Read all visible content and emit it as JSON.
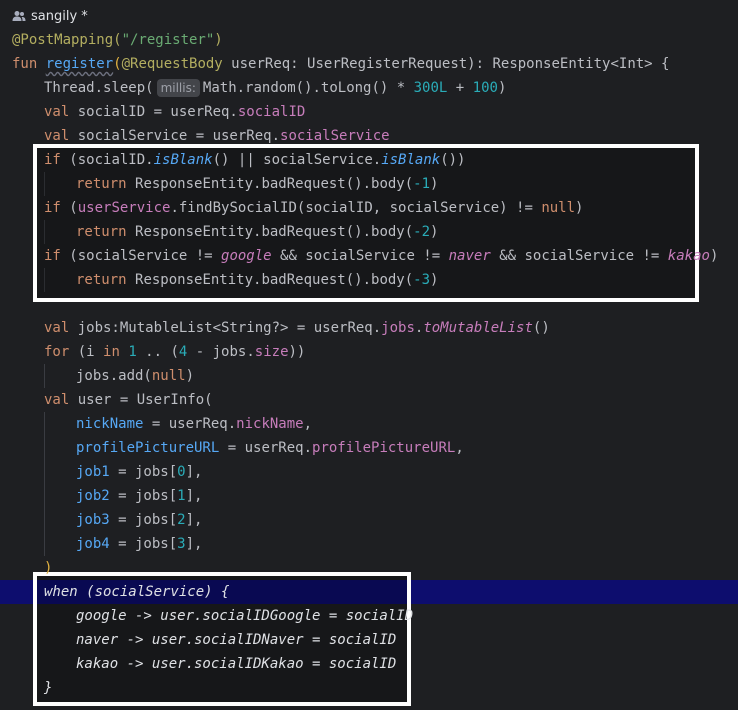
{
  "author": {
    "name": "sangily *",
    "icon": "people-icon"
  },
  "colors": {
    "background": "#1e1f22",
    "keyword": "#cf8e6d",
    "annotation": "#b3ae60",
    "string": "#6aab73",
    "number": "#2aacb8",
    "property": "#c77dbb",
    "highlight_line": "#0d0d6e",
    "box_border": "#ffffff"
  },
  "code": {
    "l1": {
      "annotation": "@PostMapping(",
      "path": "\"/register\"",
      "close": ")"
    },
    "l2": {
      "fun": "fun ",
      "name": "register",
      "open": "(",
      "ann": "@RequestBody",
      "params": " userReq: UserRegisterRequest): ResponseEntity<Int> {"
    },
    "l3": {
      "a": "Thread.sleep(",
      "hint": "millis:",
      "b": "Math.random().toLong() * ",
      "n1": "300L",
      "c": " + ",
      "n2": "100",
      "d": ")"
    },
    "l4": {
      "kw": "val ",
      "a": "socialID = userReq.",
      "prop": "socialID"
    },
    "l5": {
      "kw": "val ",
      "a": "socialService = userReq.",
      "prop": "socialService"
    },
    "l6": {
      "kw": "if ",
      "a": "(socialID.",
      "f1": "isBlank",
      "b": "() || socialService.",
      "f2": "isBlank",
      "c": "())"
    },
    "l7": {
      "kw": "return ",
      "a": "ResponseEntity.badRequest().body(",
      "n": "-1",
      "b": ")"
    },
    "l8": {
      "kw": "if ",
      "a": "(",
      "prop": "userService",
      "b": ".findBySocialID(socialID, socialService) != ",
      "kw2": "null",
      "c": ")"
    },
    "l9": {
      "kw": "return ",
      "a": "ResponseEntity.badRequest().body(",
      "n": "-2",
      "b": ")"
    },
    "l10": {
      "kw": "if ",
      "a": "(socialService != ",
      "e1": "google",
      "b": " && socialService != ",
      "e2": "naver",
      "c": " && socialService != ",
      "e3": "kakao",
      "d": ")"
    },
    "l11": {
      "kw": "return ",
      "a": "ResponseEntity.badRequest().body(",
      "n": "-3",
      "b": ")"
    },
    "l12": {
      "kw": "val ",
      "a": "jobs:MutableList<String?> = userReq.",
      "prop": "jobs",
      "b": ".",
      "f": "toMutableList",
      "c": "()"
    },
    "l13": {
      "kw": "for ",
      "a": "(i ",
      "kw2": "in ",
      "n1": "1",
      "b": " .. (",
      "n2": "4",
      "c": " - jobs.",
      "prop": "size",
      "d": "))"
    },
    "l14": {
      "a": "jobs.add(",
      "kw": "null",
      "b": ")"
    },
    "l15": {
      "kw": "val ",
      "a": "user = UserInfo("
    },
    "l16": {
      "named": "nickName",
      "a": " = userReq.",
      "prop": "nickName",
      "b": ","
    },
    "l17": {
      "named": "profilePictureURL",
      "a": " = userReq.",
      "prop": "profilePictureURL",
      "b": ","
    },
    "l18": {
      "named": "job1",
      "a": " = jobs[",
      "n": "0",
      "b": "],"
    },
    "l19": {
      "named": "job2",
      "a": " = jobs[",
      "n": "1",
      "b": "],"
    },
    "l20": {
      "named": "job3",
      "a": " = jobs[",
      "n": "2",
      "b": "],"
    },
    "l21": {
      "named": "job4",
      "a": " = jobs[",
      "n": "3",
      "b": "],"
    },
    "l22": {
      "a": ")"
    },
    "l23": {
      "a": "when (socialService) {"
    },
    "l24": {
      "a": "google -> user.socialIDGoogle = socialID"
    },
    "l25": {
      "a": "naver -> user.socialIDNaver = socialID"
    },
    "l26": {
      "a": "kakao -> user.socialIDKakao = socialID"
    },
    "l27": {
      "a": "}"
    }
  }
}
